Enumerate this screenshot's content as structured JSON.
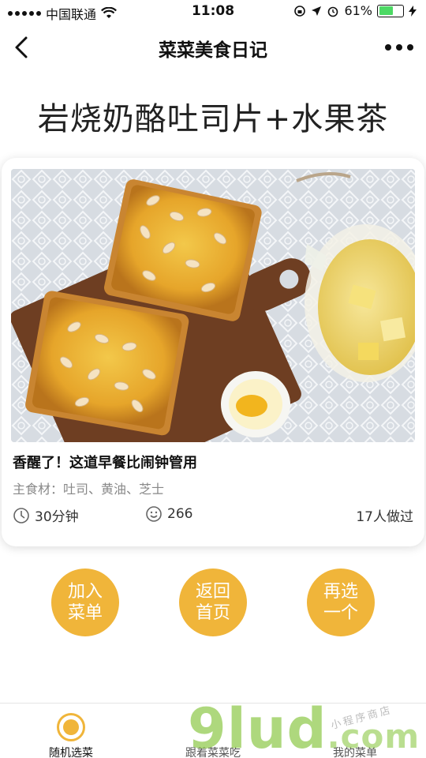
{
  "status_bar": {
    "carrier": "中国联通",
    "time": "11:08",
    "battery": "61%",
    "battery_level": 0.61
  },
  "nav": {
    "title": "菜菜美食日记",
    "back_icon": "chevron-left-icon",
    "more_icon": "more-dots-icon"
  },
  "dish": {
    "title": "岩烧奶酪吐司片+水果茶"
  },
  "card": {
    "headline": "香醒了！这道早餐比闹钟管用",
    "ingredients": "主食材：吐司、黄油、芝士",
    "time": "30分钟",
    "likes": "266",
    "cooked": "17人做过"
  },
  "actions": [
    {
      "label": "加入菜单"
    },
    {
      "label": "返回首页"
    },
    {
      "label": "再选一个"
    }
  ],
  "tabs": [
    {
      "label": "随机选菜",
      "active": true
    },
    {
      "label": "跟着菜菜吃",
      "active": false
    },
    {
      "label": "我的菜单",
      "active": false
    }
  ],
  "watermark": {
    "main": "9lud",
    "suffix": ".com",
    "small": "小程序商店"
  },
  "colors": {
    "accent": "#f0b53a",
    "battery": "#4cd964"
  }
}
